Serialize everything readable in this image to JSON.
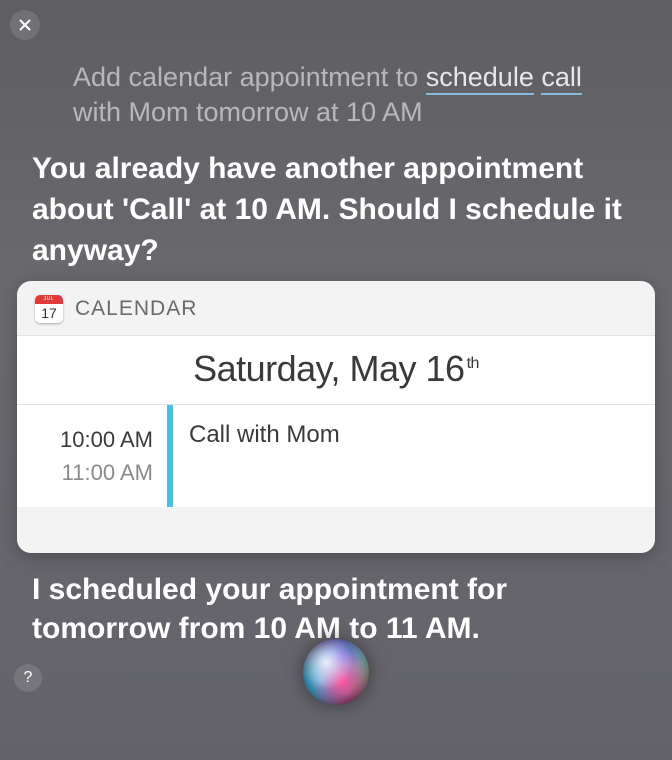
{
  "close_label": "×",
  "help_label": "?",
  "user_command": {
    "pre": "Add calendar appointment to ",
    "kw1": "schedule",
    "sep": " ",
    "kw2": "call",
    "post": " with Mom tomorrow at 10 AM"
  },
  "siri_prompt": "You already have another appointment about 'Call' at 10 AM. Should I schedule it anyway?",
  "calendar": {
    "app_label": "CALENDAR",
    "icon": {
      "month": "JUL",
      "day": "17"
    },
    "date_main": "Saturday, May 16",
    "date_suffix": "th",
    "event": {
      "start": "10:00 AM",
      "end": "11:00 AM",
      "title": "Call with Mom"
    }
  },
  "siri_confirmation": "I scheduled your appointment for tomorrow from 10 AM to 11 AM."
}
